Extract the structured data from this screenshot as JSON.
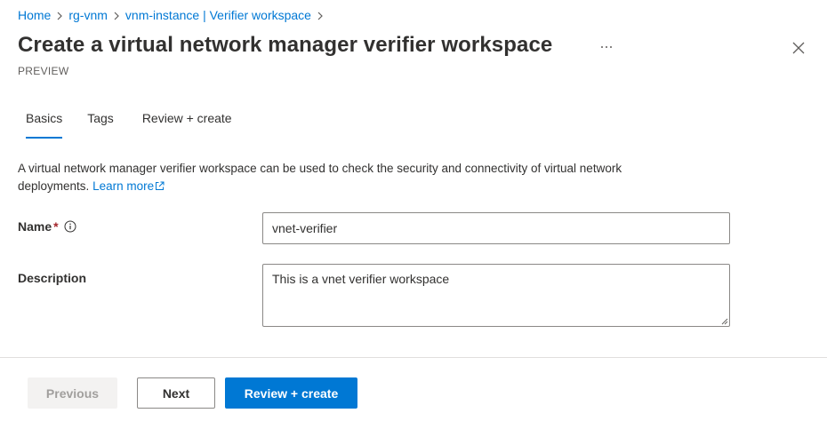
{
  "breadcrumb": {
    "items": [
      {
        "label": "Home"
      },
      {
        "label": "rg-vnm"
      },
      {
        "label": "vnm-instance | Verifier workspace"
      }
    ]
  },
  "header": {
    "title": "Create a virtual network manager verifier workspace",
    "subtitle": "PREVIEW"
  },
  "tabs": [
    {
      "label": "Basics",
      "active": true
    },
    {
      "label": "Tags",
      "active": false
    },
    {
      "label": "Review + create",
      "active": false
    }
  ],
  "intro": {
    "text": "A virtual network manager verifier workspace can be used to check the security and connectivity of virtual network deployments.",
    "link_label": "Learn more"
  },
  "form": {
    "name": {
      "label": "Name",
      "required_mark": "*",
      "value": "vnet-verifier"
    },
    "description": {
      "label": "Description",
      "value": "This is a vnet verifier workspace"
    }
  },
  "footer": {
    "previous_label": "Previous",
    "next_label": "Next",
    "review_label": "Review + create"
  },
  "colors": {
    "accent": "#0078d4",
    "text": "#323130",
    "required": "#a4262c",
    "disabled_bg": "#f3f2f1"
  }
}
